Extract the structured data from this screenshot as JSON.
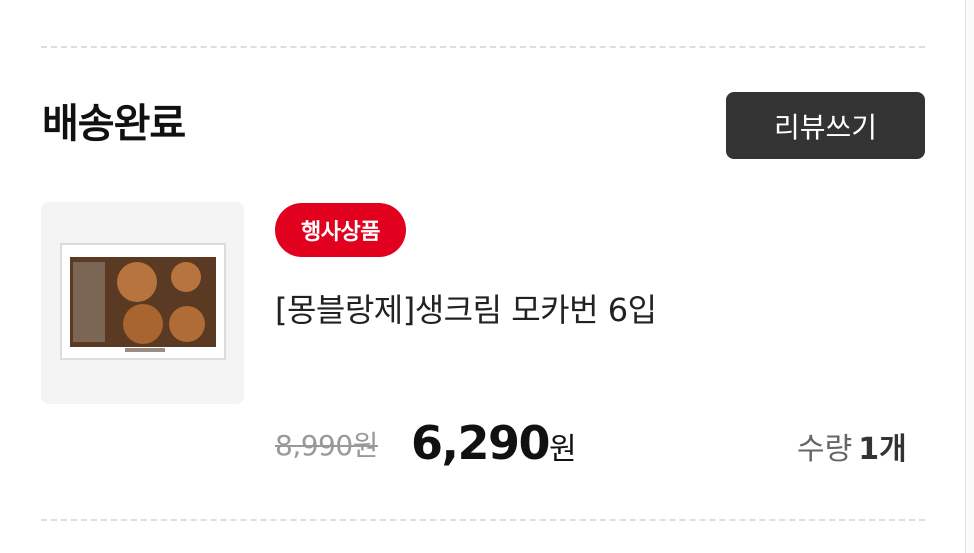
{
  "order": {
    "status_title": "배송완료",
    "review_button_label": "리뷰쓰기"
  },
  "product": {
    "badge": "행사상품",
    "name": "[몽블랑제]생크림 모카번 6입",
    "original_price": "8,990원",
    "sale_price_number": "6,290",
    "sale_price_unit": "원",
    "quantity_label": "수량",
    "quantity_value": "1개",
    "thumbnail_icon": "product-image-icon"
  },
  "colors": {
    "badge_bg": "#e2001f",
    "button_bg": "#333333",
    "strike_price": "#999999"
  }
}
